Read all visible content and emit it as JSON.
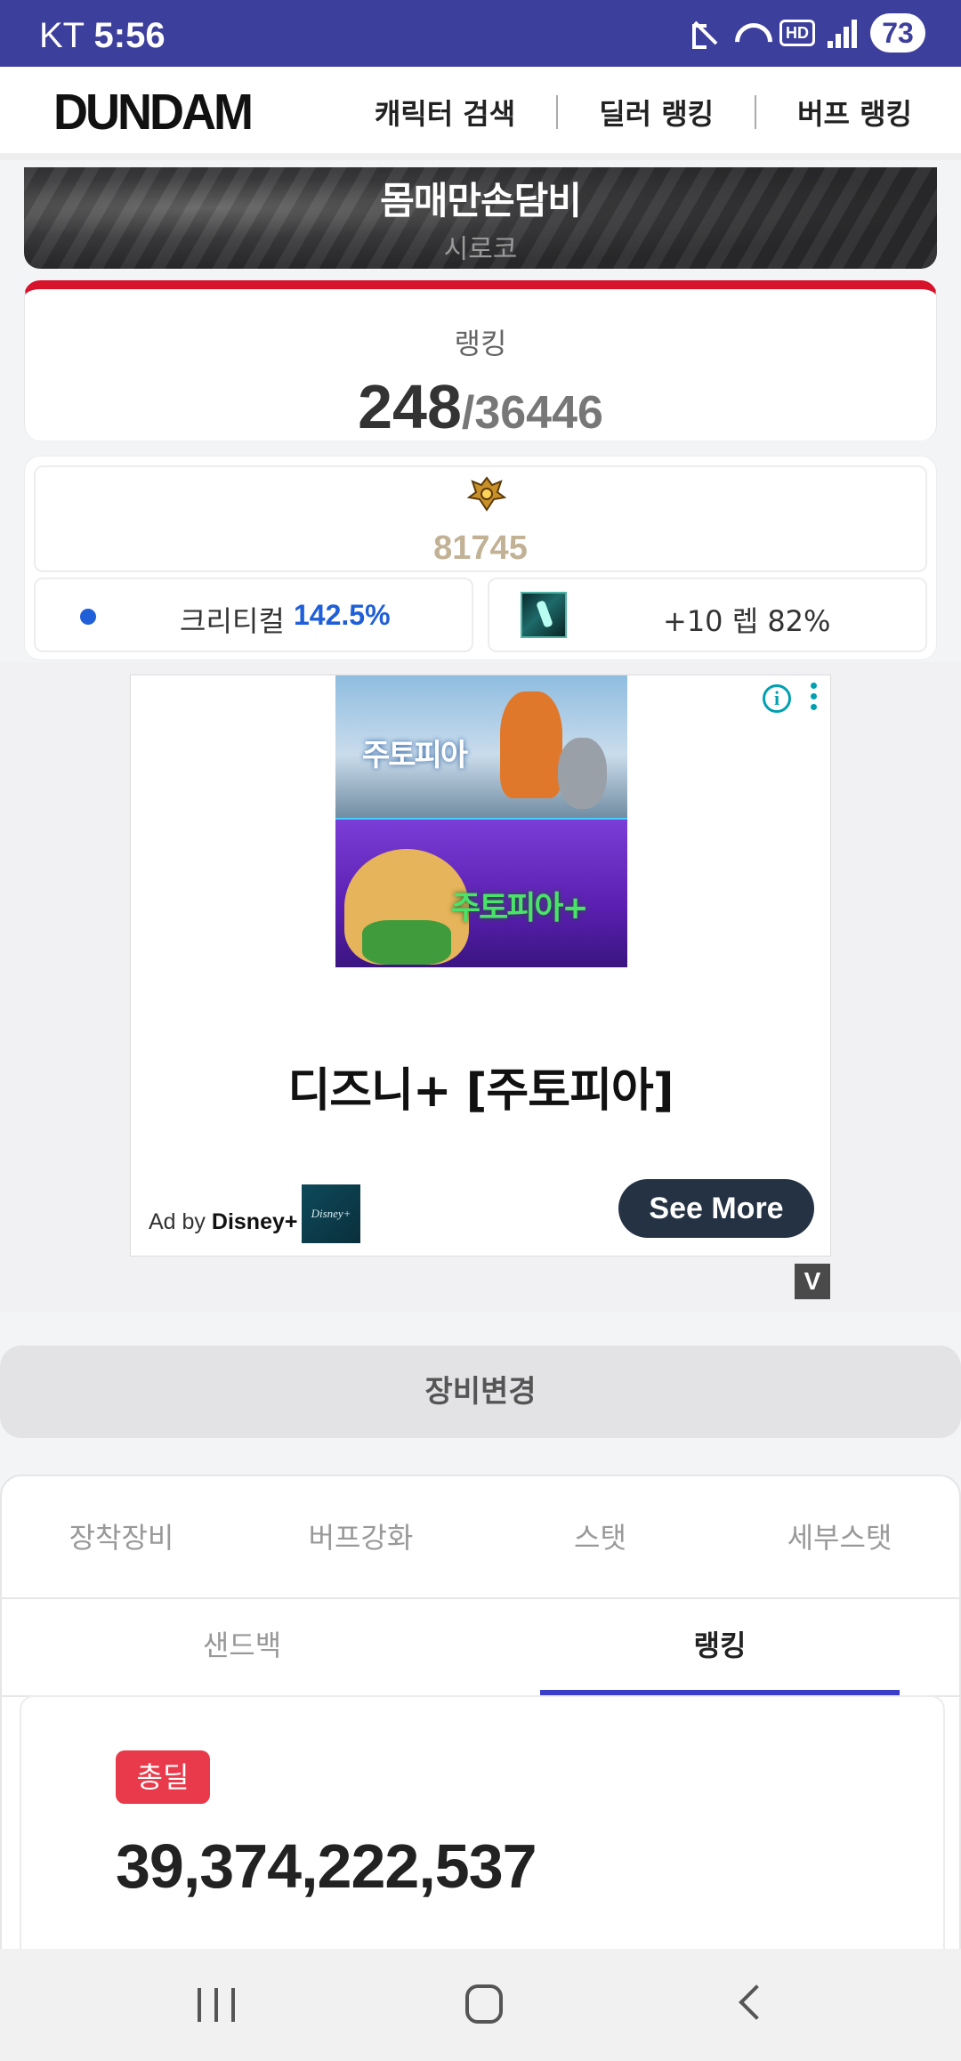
{
  "status_bar": {
    "carrier": "KT",
    "time": "5:56",
    "hd_label": "HD",
    "battery": "73"
  },
  "header": {
    "logo": "DUNDAM",
    "nav": [
      "캐릭터 검색",
      "딜러 랭킹",
      "버프 랭킹"
    ]
  },
  "character": {
    "name": "몸매만손담비",
    "server": "시로코"
  },
  "ranking": {
    "label": "랭킹",
    "rank": "248",
    "total": "/36446"
  },
  "stats": {
    "power": "81745",
    "crit_label": "크리티컬",
    "crit_value": "142.5%",
    "skill_text": "+10 렙 82%"
  },
  "ad": {
    "poster_title_1": "주토피아",
    "poster_title_2": "주토피아+",
    "title": "디즈니+ [주토피아]",
    "by_prefix": "Ad by",
    "brand": "Disney+",
    "brand_logo_text": "Disney+",
    "cta": "See More",
    "badge": "V"
  },
  "equip_change": "장비변경",
  "tabs": {
    "main": [
      "장착장비",
      "버프강화",
      "스탯",
      "세부스탯"
    ],
    "sub": [
      "샌드백",
      "랭킹"
    ]
  },
  "score": {
    "badge": "총딜",
    "value": "39,374,222,537"
  },
  "colors": {
    "status_bar": "#3d3f9c",
    "rank_accent": "#d7122b",
    "crit_blue": "#1f5fd8",
    "power_gold": "#c2b295",
    "active_tab": "#3b3ec9",
    "total_badge": "#e83a4a"
  }
}
